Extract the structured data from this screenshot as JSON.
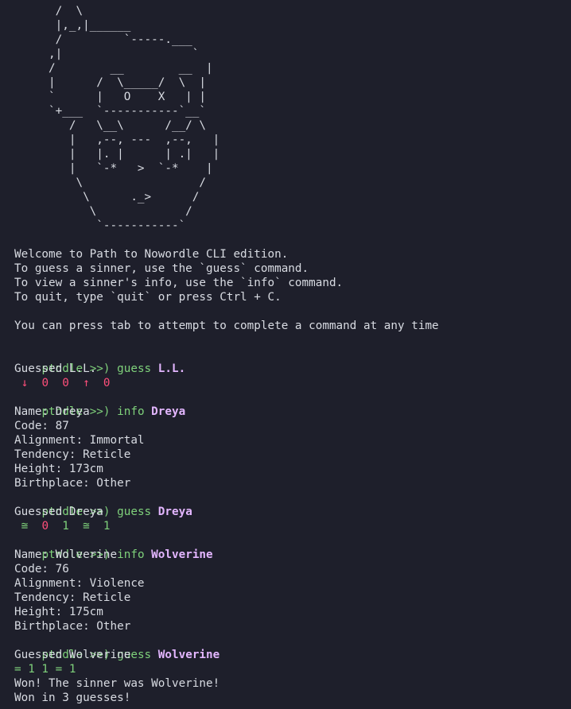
{
  "ascii_art": "      /  \\\n      |,_,|______\n      /         `-----.___\n     ,|                   `\n     /        __        __  |\n     |      /  \\_____/  \\  |\n     `      |   O    X   | |\n     `+___  `-----------`__`\n        /   \\__\\      /__/ \\\n        |   ,--, ---  ,--,   |\n        |   |. |      | .|   |\n        |   `-*   >  `-*    |\n         \\                 /\n          \\      ._>      /\n           \\             /\n            `-----------`",
  "intro": {
    "line1": "Welcome to Path to Nowordle CLI edition.",
    "line2": "To guess a sinner, use the `guess` command.",
    "line3": "To view a sinner's info, use the `info` command.",
    "line4": "To quit, type `quit` or press Ctrl + C.",
    "line5": "You can press tab to attempt to complete a command at any time"
  },
  "prompt": "ptndle >>)",
  "session": {
    "c1": {
      "cmd": "guess",
      "arg": "L.L."
    },
    "c1_out": "Guessed L.L.",
    "c1_feedback": [
      {
        "glyph": "↓",
        "color": "red"
      },
      {
        "glyph": "0",
        "color": "red"
      },
      {
        "glyph": "0",
        "color": "red"
      },
      {
        "glyph": "↑",
        "color": "red"
      },
      {
        "glyph": "0",
        "color": "red"
      }
    ],
    "c2": {
      "cmd": "info",
      "arg": "Dreya"
    },
    "c2_info": {
      "name": "Name: Dreya",
      "code": "Code: 87",
      "alignment": "Alignment: Immortal",
      "tendency": "Tendency: Reticle",
      "height": "Height: 173cm",
      "birthplace": "Birthplace: Other"
    },
    "c3": {
      "cmd": "guess",
      "arg": "Dreya"
    },
    "c3_out": "Guessed Dreya",
    "c3_feedback": [
      {
        "glyph": "≅",
        "color": "green"
      },
      {
        "glyph": "0",
        "color": "red"
      },
      {
        "glyph": "1",
        "color": "green"
      },
      {
        "glyph": "≅",
        "color": "green"
      },
      {
        "glyph": "1",
        "color": "green"
      }
    ],
    "c4": {
      "cmd": "info",
      "arg": "Wolverine"
    },
    "c4_info": {
      "name": "Name: Wolverine",
      "code": "Code: 76",
      "alignment": "Alignment: Violence",
      "tendency": "Tendency: Reticle",
      "height": "Height: 175cm",
      "birthplace": "Birthplace: Other"
    },
    "c5": {
      "cmd": "guess",
      "arg": "Wolverine"
    },
    "c5_out": "Guessed Wolverine",
    "c5_feedback": "= 1 1 = 1",
    "won_line": "Won! The sinner was Wolverine!",
    "won_count": "Won in 3 guesses!"
  },
  "colors": {
    "background": "#1e1f2b",
    "text": "#d8dbe2",
    "prompt": "#7fd17b",
    "argument": "#e3b6ff",
    "wrong": "#ff4f7b",
    "correct": "#7fd17b"
  }
}
